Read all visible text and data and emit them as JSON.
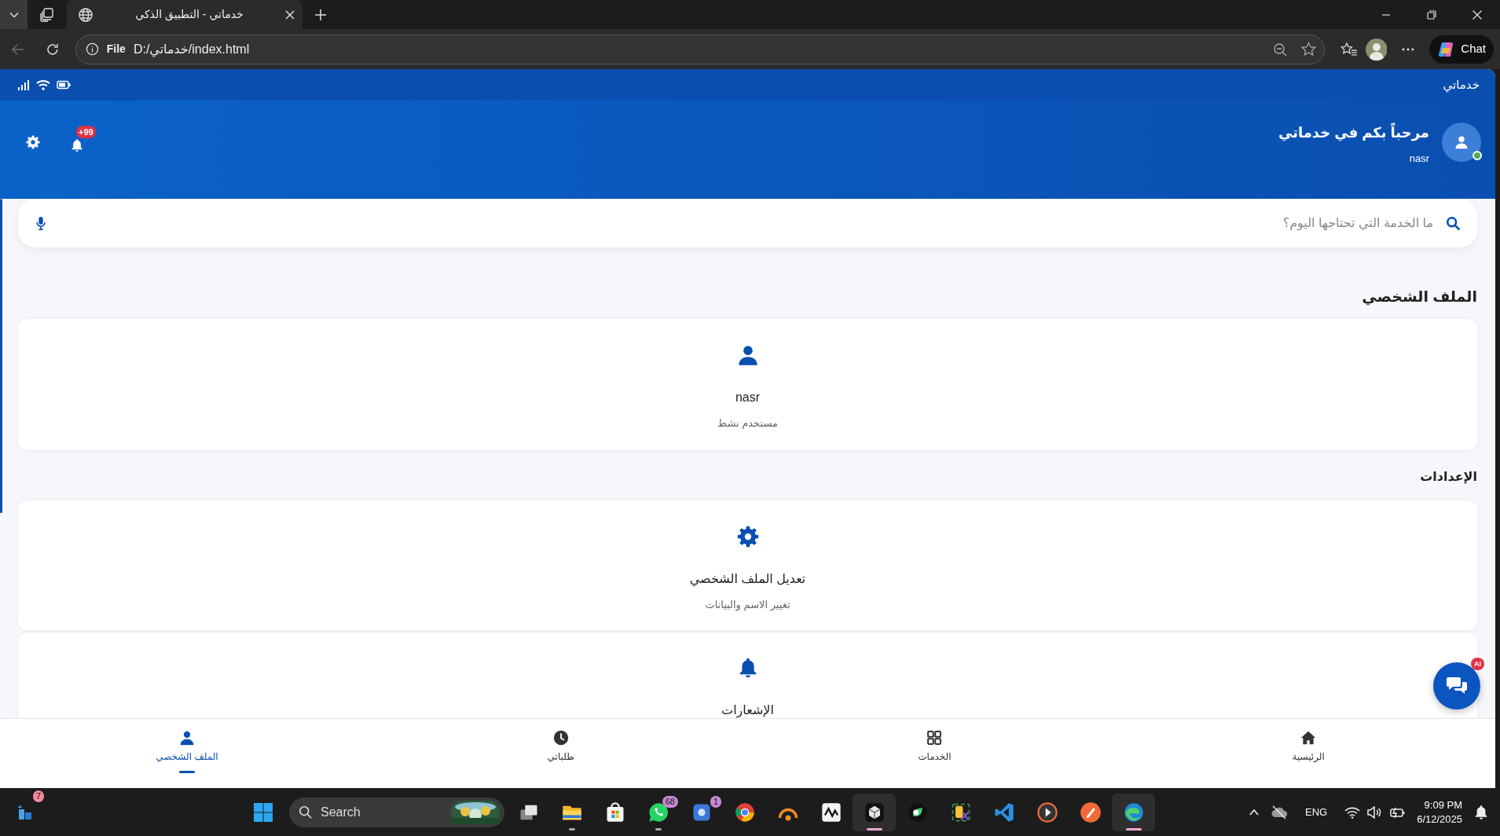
{
  "browser": {
    "tab": {
      "title": "خدماتي - التطبيق الذكي",
      "selected": true
    },
    "back_disabled": true,
    "address": {
      "scheme": "File",
      "url": "D:/خدماتي/index.html"
    },
    "chat_label": "Chat"
  },
  "app": {
    "status_bar": {
      "title": "خدماتي"
    },
    "header": {
      "welcome": "مرحباً بكم في خدماتي",
      "username": "nasr",
      "online": true,
      "notifications": "+99"
    },
    "search": {
      "placeholder": "ما الخدمة التي تحتاجها اليوم؟"
    },
    "sections": [
      {
        "title": "الملف الشخصي",
        "cards": [
          {
            "kind": "person",
            "title": "nasr",
            "subtitle": "مستخدم نشط"
          }
        ]
      },
      {
        "title": "الإعدادات",
        "cards": [
          {
            "kind": "gear",
            "title": "تعديل الملف الشخصي",
            "subtitle": "تغيير الاسم والبيانات"
          },
          {
            "kind": "bell",
            "title": "الإشعارات"
          }
        ]
      }
    ],
    "assistant": {
      "badge": "AI"
    },
    "bottom_nav": [
      {
        "kind": "home",
        "label": "الرئيسية",
        "selected": false
      },
      {
        "kind": "grid",
        "label": "الخدمات",
        "selected": false
      },
      {
        "kind": "clock",
        "label": "طلباتي",
        "selected": false
      },
      {
        "kind": "person",
        "label": "الملف الشخصي",
        "selected": true
      }
    ]
  },
  "taskbar": {
    "widgets_badge": "7",
    "search": "Search",
    "apps": [
      {
        "kind": "task-view",
        "running": false,
        "selected": false
      },
      {
        "kind": "folder",
        "running": true,
        "selected": false
      },
      {
        "kind": "store",
        "running": false,
        "selected": false
      },
      {
        "kind": "whatsapp",
        "running": true,
        "selected": false,
        "badge": "68"
      }
    ],
    "apps_2": [
      {
        "kind": "blue-app",
        "running": false,
        "selected": false,
        "badge": "1"
      },
      {
        "kind": "chrome",
        "running": false,
        "selected": false
      },
      {
        "kind": "orange-app",
        "running": false,
        "selected": false
      },
      {
        "kind": "zigzag",
        "running": false,
        "selected": false
      },
      {
        "kind": "cube",
        "running": true,
        "selected": true
      },
      {
        "kind": "green-app",
        "running": false,
        "selected": false
      },
      {
        "kind": "tools",
        "running": false,
        "selected": false
      },
      {
        "kind": "code",
        "running": false,
        "selected": false
      },
      {
        "kind": "play",
        "running": false,
        "selected": false
      },
      {
        "kind": "pen",
        "running": false,
        "selected": false
      },
      {
        "kind": "edge",
        "running": true,
        "selected": true
      }
    ],
    "tray": {
      "language": "ENG",
      "time": "9:09 PM",
      "date": "6/12/2025"
    }
  }
}
